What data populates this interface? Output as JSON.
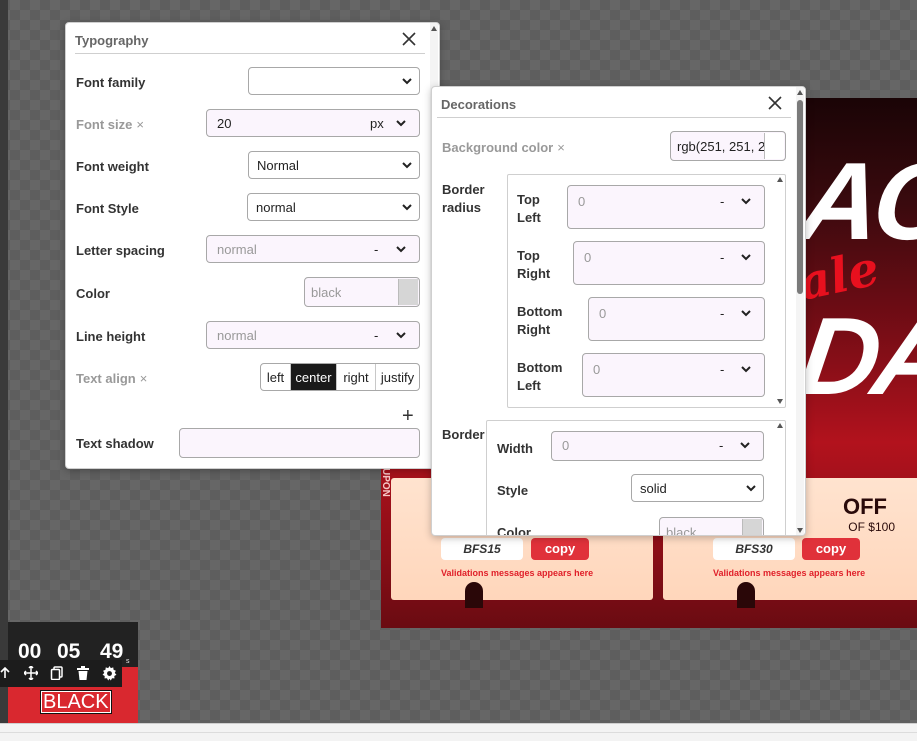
{
  "typography": {
    "title": "Typography",
    "font_family": {
      "label": "Font family",
      "value": ""
    },
    "font_size": {
      "label": "Font size",
      "value": "20",
      "unit": "px"
    },
    "font_weight": {
      "label": "Font weight",
      "value": "Normal"
    },
    "font_style": {
      "label": "Font Style",
      "value": "normal"
    },
    "letter_spacing": {
      "label": "Letter spacing",
      "placeholder": "normal",
      "unit": "-"
    },
    "color": {
      "label": "Color",
      "placeholder": "black"
    },
    "line_height": {
      "label": "Line height",
      "placeholder": "normal",
      "unit": "-"
    },
    "text_align": {
      "label": "Text align",
      "options": [
        "left",
        "center",
        "right",
        "justify"
      ],
      "selected": "center"
    },
    "text_shadow": {
      "label": "Text shadow",
      "add": "+"
    },
    "clear_mark": "×"
  },
  "decorations": {
    "title": "Decorations",
    "background_color": {
      "label": "Background color",
      "value": "rgb(251, 251, 2"
    },
    "border_radius": {
      "label_line1": "Border",
      "label_line2": "radius",
      "corners": [
        {
          "line1": "Top",
          "line2": "Left",
          "value": "0",
          "unit": "-"
        },
        {
          "line1": "Top",
          "line2": "Right",
          "value": "0",
          "unit": "-"
        },
        {
          "line1": "Bottom",
          "line2": "Right",
          "value": "0",
          "unit": "-"
        },
        {
          "line1": "Bottom",
          "line2": "Left",
          "value": "0",
          "unit": "-"
        }
      ]
    },
    "border": {
      "label": "Border",
      "width": {
        "label": "Width",
        "value": "0",
        "unit": "-"
      },
      "style": {
        "label": "Style",
        "value": "solid"
      },
      "color": {
        "label": "Color",
        "placeholder": "black"
      }
    }
  },
  "promo": {
    "line1": "AC",
    "script": "ale",
    "line2": "DA",
    "coupons": [
      {
        "code": "BFS15",
        "copy": "copy",
        "message": "Validations messages appears here",
        "side_text": "UPON"
      },
      {
        "code": "BFS30",
        "copy": "copy",
        "message": "Validations messages appears here",
        "off": "OFF",
        "off_sub": "OF $100"
      }
    ]
  },
  "timer": {
    "hours": "00",
    "minutes": "05",
    "seconds": "49",
    "seconds_unit": "s",
    "text": "BLACK"
  },
  "toolbar_icons": [
    "arrow-up-icon",
    "move-icon",
    "copy-icon",
    "trash-icon",
    "gear-icon"
  ],
  "colors": {
    "active_align": "#1a1a1a",
    "copy_button": "#e0313a",
    "validation_text": "#e0202a",
    "timer_bg": "#d9282f",
    "input_bg": "#fbf5fd"
  }
}
